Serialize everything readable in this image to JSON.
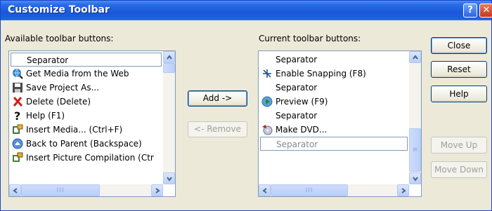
{
  "window": {
    "title": "Customize Toolbar"
  },
  "titlebar": {
    "help_label": "?",
    "close_label": "✕"
  },
  "available": {
    "label": "Available toolbar buttons:",
    "items": [
      {
        "label": "Separator",
        "icon": "none",
        "selected": true
      },
      {
        "label": "Get Media from the Web",
        "icon": "globe-search-icon"
      },
      {
        "label": "Save Project As...",
        "icon": "save-icon"
      },
      {
        "label": "Delete (Delete)",
        "icon": "delete-x-icon"
      },
      {
        "label": "Help (F1)",
        "icon": "question-icon"
      },
      {
        "label": "Insert Media... (Ctrl+F)",
        "icon": "insert-media-icon"
      },
      {
        "label": "Back to Parent (Backspace)",
        "icon": "up-arrow-circle-icon"
      },
      {
        "label": "Insert Picture Compilation (Ctr",
        "icon": "picture-compilation-icon"
      }
    ]
  },
  "current": {
    "label": "Current toolbar buttons:",
    "items": [
      {
        "label": "Separator",
        "icon": "none"
      },
      {
        "label": "Enable Snapping (F8)",
        "icon": "snapping-icon"
      },
      {
        "label": "Separator",
        "icon": "none"
      },
      {
        "label": "Preview (F9)",
        "icon": "preview-icon"
      },
      {
        "label": "Separator",
        "icon": "none"
      },
      {
        "label": "Make DVD...",
        "icon": "make-dvd-icon"
      },
      {
        "label": "Separator",
        "icon": "none",
        "selected": true,
        "dim": true
      }
    ]
  },
  "buttons": {
    "add": "Add ->",
    "remove": "<- Remove",
    "close": "Close",
    "reset": "Reset",
    "help": "Help",
    "move_up": "Move Up",
    "move_down": "Move Down"
  },
  "scroll_grip": "III",
  "colors": {
    "titlebar": "#1a58d8",
    "dialog": "#ece9d8",
    "list_border": "#7f9db9"
  }
}
